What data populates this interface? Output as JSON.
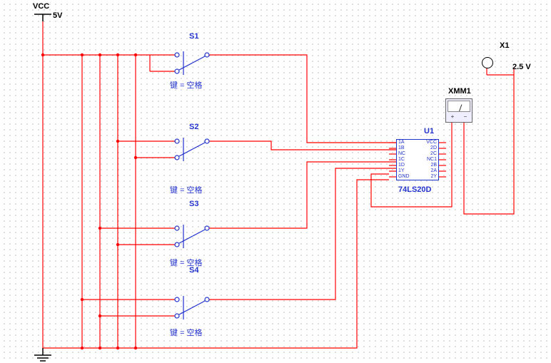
{
  "power": {
    "vcc_label": "VCC",
    "vcc_value": "5V"
  },
  "switches": {
    "s1": {
      "name": "S1",
      "key_label": "键 = 空格"
    },
    "s2": {
      "name": "S2",
      "key_label": "键 = 空格"
    },
    "s3": {
      "name": "S3",
      "key_label": "键 = 空格"
    },
    "s4": {
      "name": "S4",
      "key_label": "键 = 空格"
    }
  },
  "ic": {
    "ref": "U1",
    "part": "74LS20D",
    "pins_left": [
      "1A",
      "1B",
      "NC",
      "1C",
      "1D",
      "1Y",
      "GND"
    ],
    "pins_right": [
      "VCC",
      "2D",
      "2C",
      "NC1",
      "2B",
      "2A",
      "2Y"
    ]
  },
  "meter": {
    "ref": "XMM1"
  },
  "probe": {
    "ref": "X1",
    "reading": "2.5 V"
  },
  "wire_color": "#ff0000",
  "comp_color": "#2233cc"
}
